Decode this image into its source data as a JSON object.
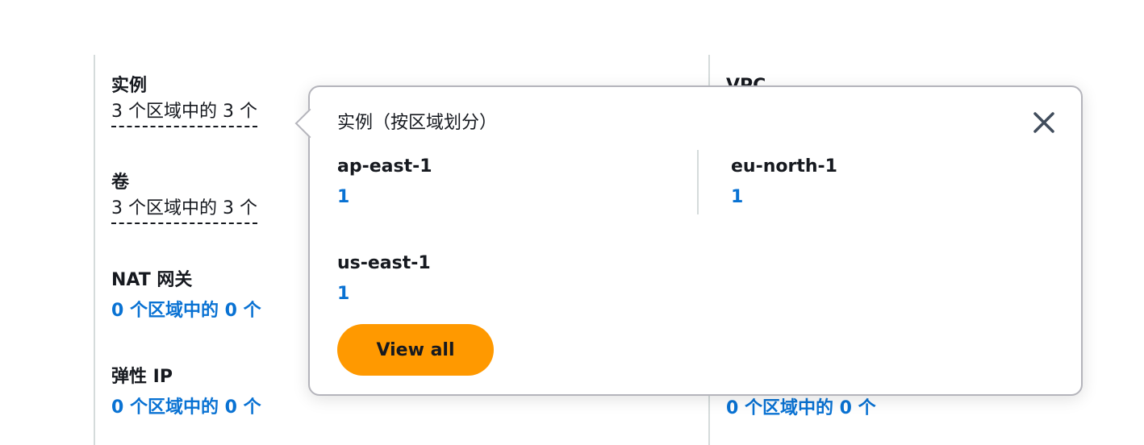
{
  "left_column": [
    {
      "label": "实例",
      "value": "3 个区域中的 3 个",
      "style": "dashed"
    },
    {
      "label": "卷",
      "value": "3 个区域中的 3 个",
      "style": "dashed"
    },
    {
      "label": "NAT 网关",
      "value": "0 个区域中的 0 个",
      "style": "link"
    },
    {
      "label": "弹性 IP",
      "value": "0 个区域中的 0 个",
      "style": "link"
    }
  ],
  "right_column": [
    {
      "label": "VPC",
      "value": "0 个区域中的 0 个"
    }
  ],
  "popover": {
    "title": "实例（按区域划分）",
    "close_icon": "close-icon",
    "regions": [
      {
        "name": "ap-east-1",
        "count": "1"
      },
      {
        "name": "eu-north-1",
        "count": "1"
      },
      {
        "name": "us-east-1",
        "count": "1"
      }
    ],
    "view_all_label": "View all"
  },
  "colors": {
    "link": "#0972d3",
    "button": "#ff9900",
    "text": "#16191f"
  }
}
